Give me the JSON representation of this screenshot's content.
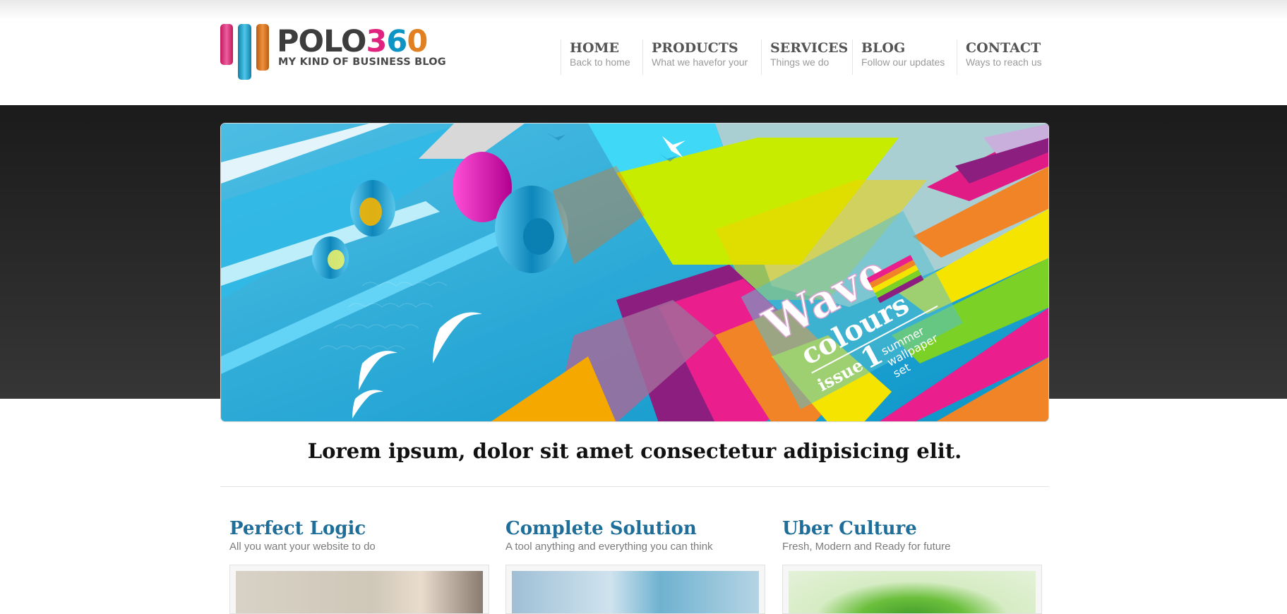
{
  "logo": {
    "word_a": "POLO",
    "digit_1": "3",
    "digit_2": "6",
    "digit_3": "0",
    "tagline": "MY KIND OF BUSINESS BLOG"
  },
  "nav": [
    {
      "title": "HOME",
      "sub": "Back to home"
    },
    {
      "title": "PRODUCTS",
      "sub": "What we havefor your"
    },
    {
      "title": "SERVICES",
      "sub": "Things we do"
    },
    {
      "title": "BLOG",
      "sub": "Follow our updates"
    },
    {
      "title": "CONTACT",
      "sub": "Ways to reach us"
    }
  ],
  "hero": {
    "title_1": "Wave",
    "title_2": "colours",
    "issue": "issue",
    "issue_num": "1",
    "line_1": "summer",
    "line_2": "wallpaper",
    "line_3": "set"
  },
  "headline": "Lorem ipsum, dolor sit amet consectetur adipisicing elit.",
  "features": [
    {
      "title": "Perfect Logic",
      "sub": "All you want your website to do"
    },
    {
      "title": "Complete Solution",
      "sub": "A tool anything and everything you can think"
    },
    {
      "title": "Uber Culture",
      "sub": "Fresh, Modern and Ready for future"
    }
  ],
  "colors": {
    "brand_pink": "#e0237e",
    "brand_blue": "#0e94c4",
    "brand_orange": "#e08020",
    "feature_title": "#1f6e9a",
    "dark_band": "#1b1b1b"
  }
}
